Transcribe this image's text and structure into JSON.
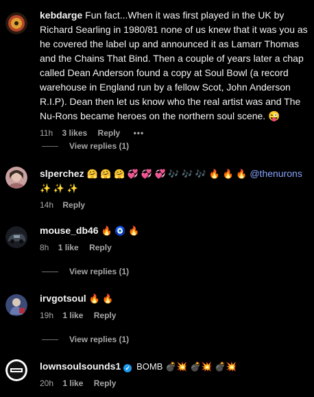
{
  "comments": [
    {
      "username": "kebdarge",
      "text": "Fun fact...When it was first played in the UK by Richard Searling in 1980/81 none of us knew that it was you as he covered the label up and announced it as Lamarr Thomas and the Chains That Bind. Then a couple of years later a chap called Dean Anderson found a copy at Soul Bowl (a record warehouse in England run by a fellow Scot, John Anderson R.I.P). Dean then let us know who the real artist was and The Nu-Rons became heroes on the northern soul scene. 😜",
      "time": "11h",
      "likes": "3 likes",
      "reply": "Reply",
      "more": "•••",
      "view_replies": "View replies (1)"
    },
    {
      "username": "slperchez",
      "text": "🤗 🤗 🤗 💞 💞 💞 🎶 🎶 🎶 🔥 🔥 🔥",
      "mention": "@thenurons",
      "text2": "✨ ✨ ✨",
      "time": "14h",
      "reply": "Reply"
    },
    {
      "username": "mouse_db46",
      "text": "🔥 🧿 🔥",
      "time": "8h",
      "likes": "1 like",
      "reply": "Reply",
      "view_replies": "View replies (1)"
    },
    {
      "username": "irvgotsoul",
      "text": "🔥 🔥",
      "time": "19h",
      "likes": "1 like",
      "reply": "Reply",
      "view_replies": "View replies (1)"
    },
    {
      "username": "lownsoulsounds1",
      "verified": "✓",
      "text": "BOMB 💣💥 💣💥 💣💥",
      "time": "20h",
      "likes": "1 like",
      "reply": "Reply"
    }
  ],
  "colors": {
    "background": "#000000",
    "text": "#f5f5f5",
    "meta": "#a8a8a8",
    "mention": "#8aa4ff",
    "verified": "#1d9bf0"
  }
}
